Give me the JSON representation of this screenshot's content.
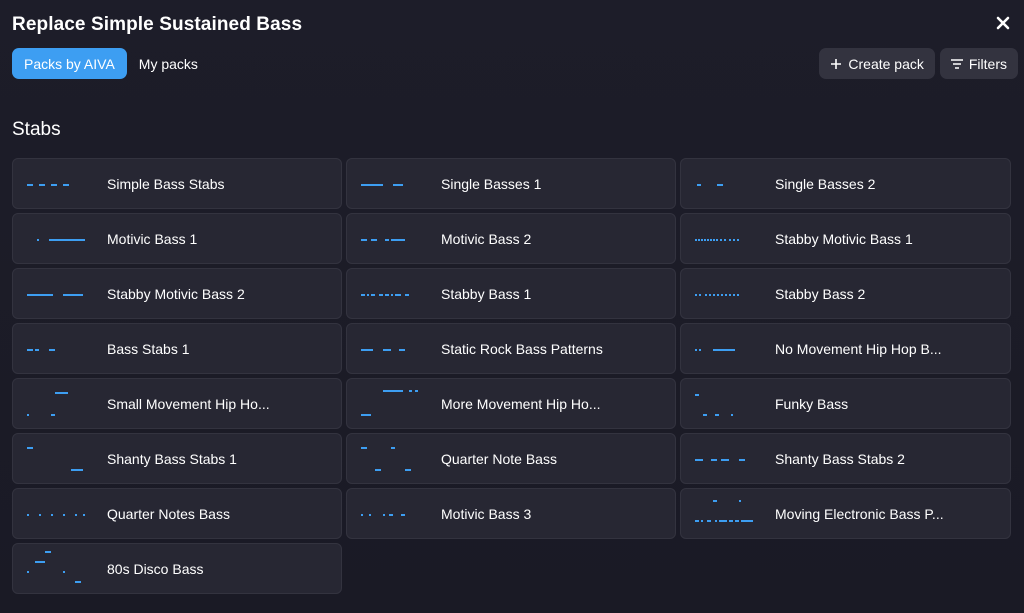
{
  "dialog": {
    "title": "Replace Simple Sustained Bass",
    "close_icon": "close-icon"
  },
  "tabs": [
    {
      "label": "Packs by AIVA",
      "active": true
    },
    {
      "label": "My packs",
      "active": false
    }
  ],
  "toolbar": {
    "create_pack_label": "Create pack",
    "create_pack_icon": "plus-icon",
    "filters_label": "Filters",
    "filters_icon": "filter-icon"
  },
  "section": {
    "title": "Stabs"
  },
  "colors": {
    "accent": "#3d9ef2",
    "card_bg": "#272733",
    "button_bg": "#33333f",
    "background": "#1d1d29"
  },
  "packs": [
    {
      "name": "Simple Bass Stabs",
      "notes": [
        [
          2,
          20,
          6
        ],
        [
          14,
          20,
          6
        ],
        [
          26,
          20,
          6
        ],
        [
          38,
          20,
          6
        ]
      ]
    },
    {
      "name": "Single Basses 1",
      "notes": [
        [
          2,
          20,
          22
        ],
        [
          34,
          20,
          10
        ]
      ]
    },
    {
      "name": "Single Basses 2",
      "notes": [
        [
          4,
          20,
          4
        ],
        [
          24,
          20,
          6
        ]
      ]
    },
    {
      "name": "Motivic Bass 1",
      "notes": [
        [
          12,
          20,
          2
        ],
        [
          24,
          20,
          36
        ]
      ]
    },
    {
      "name": "Motivic Bass 2",
      "notes": [
        [
          2,
          20,
          6
        ],
        [
          12,
          20,
          6
        ],
        [
          26,
          20,
          4
        ],
        [
          32,
          20,
          14
        ]
      ]
    },
    {
      "name": "Stabby Motivic Bass 1",
      "notes": [
        [
          2,
          20,
          2
        ],
        [
          5,
          20,
          2
        ],
        [
          8,
          20,
          2
        ],
        [
          11,
          20,
          2
        ],
        [
          14,
          20,
          2
        ],
        [
          17,
          20,
          2
        ],
        [
          20,
          20,
          2
        ],
        [
          23,
          20,
          2
        ],
        [
          27,
          20,
          2
        ],
        [
          31,
          20,
          2
        ],
        [
          36,
          20,
          2
        ],
        [
          40,
          20,
          2
        ],
        [
          44,
          20,
          2
        ]
      ]
    },
    {
      "name": "Stabby Motivic Bass 2",
      "notes": [
        [
          2,
          20,
          24
        ],
        [
          26,
          20,
          2
        ],
        [
          38,
          20,
          20
        ]
      ]
    },
    {
      "name": "Stabby Bass 1",
      "notes": [
        [
          2,
          20,
          4
        ],
        [
          8,
          20,
          2
        ],
        [
          12,
          20,
          4
        ],
        [
          20,
          20,
          4
        ],
        [
          26,
          20,
          4
        ],
        [
          32,
          20,
          2
        ],
        [
          36,
          20,
          6
        ],
        [
          46,
          20,
          4
        ]
      ]
    },
    {
      "name": "Stabby Bass 2",
      "notes": [
        [
          2,
          20,
          2
        ],
        [
          6,
          20,
          2
        ],
        [
          12,
          20,
          2
        ],
        [
          16,
          20,
          2
        ],
        [
          20,
          20,
          2
        ],
        [
          24,
          20,
          2
        ],
        [
          28,
          20,
          2
        ],
        [
          32,
          20,
          2
        ],
        [
          36,
          20,
          2
        ],
        [
          40,
          20,
          2
        ],
        [
          44,
          20,
          2
        ]
      ]
    },
    {
      "name": "Bass Stabs 1",
      "notes": [
        [
          2,
          20,
          6
        ],
        [
          10,
          20,
          4
        ],
        [
          24,
          20,
          6
        ]
      ]
    },
    {
      "name": "Static Rock Bass Patterns",
      "notes": [
        [
          2,
          20,
          12
        ],
        [
          24,
          20,
          8
        ],
        [
          40,
          20,
          6
        ]
      ]
    },
    {
      "name": "No Movement Hip Hop Bass",
      "display_name": "No Movement Hip Hop B...",
      "notes": [
        [
          2,
          20,
          2
        ],
        [
          6,
          20,
          2
        ],
        [
          20,
          20,
          22
        ]
      ]
    },
    {
      "name": "Small Movement Hip Hop Bass",
      "display_name": "Small Movement Hip Ho...",
      "notes": [
        [
          30,
          8,
          10
        ],
        [
          40,
          8,
          3
        ],
        [
          2,
          30,
          2
        ],
        [
          26,
          30,
          4
        ]
      ]
    },
    {
      "name": "More Movement Hip Hop Bass",
      "display_name": "More Movement Hip Ho...",
      "notes": [
        [
          24,
          6,
          20
        ],
        [
          50,
          6,
          3
        ],
        [
          56,
          6,
          3
        ],
        [
          2,
          30,
          10
        ]
      ]
    },
    {
      "name": "Funky Bass",
      "notes": [
        [
          2,
          10,
          4
        ],
        [
          10,
          30,
          4
        ],
        [
          22,
          30,
          4
        ],
        [
          38,
          30,
          2
        ]
      ]
    },
    {
      "name": "Shanty Bass Stabs 1",
      "notes": [
        [
          2,
          8,
          6
        ],
        [
          46,
          30,
          12
        ]
      ]
    },
    {
      "name": "Quarter Note Bass",
      "notes": [
        [
          2,
          8,
          6
        ],
        [
          32,
          8,
          4
        ],
        [
          16,
          30,
          6
        ],
        [
          46,
          30,
          6
        ]
      ]
    },
    {
      "name": "Shanty Bass Stabs 2",
      "notes": [
        [
          2,
          20,
          8
        ],
        [
          18,
          20,
          6
        ],
        [
          28,
          20,
          8
        ],
        [
          46,
          20,
          6
        ]
      ]
    },
    {
      "name": "Quarter Notes Bass",
      "notes": [
        [
          2,
          20,
          2
        ],
        [
          14,
          20,
          2
        ],
        [
          26,
          20,
          2
        ],
        [
          38,
          20,
          2
        ],
        [
          50,
          20,
          2
        ],
        [
          58,
          20,
          2
        ]
      ]
    },
    {
      "name": "Motivic Bass 3",
      "notes": [
        [
          2,
          20,
          2
        ],
        [
          10,
          20,
          2
        ],
        [
          24,
          20,
          2
        ],
        [
          30,
          20,
          4
        ],
        [
          42,
          20,
          4
        ]
      ]
    },
    {
      "name": "Moving Electronic Bass Patterns",
      "display_name": "Moving Electronic Bass P...",
      "notes": [
        [
          20,
          6,
          4
        ],
        [
          46,
          6,
          2
        ],
        [
          2,
          26,
          4
        ],
        [
          8,
          26,
          2
        ],
        [
          14,
          26,
          4
        ],
        [
          22,
          26,
          2
        ],
        [
          26,
          26,
          8
        ],
        [
          36,
          26,
          4
        ],
        [
          42,
          26,
          4
        ],
        [
          48,
          26,
          12
        ]
      ]
    },
    {
      "name": "80s Disco Bass",
      "notes": [
        [
          20,
          2,
          6
        ],
        [
          10,
          12,
          10
        ],
        [
          2,
          22,
          2
        ],
        [
          38,
          22,
          2
        ],
        [
          50,
          32,
          6
        ]
      ]
    }
  ]
}
